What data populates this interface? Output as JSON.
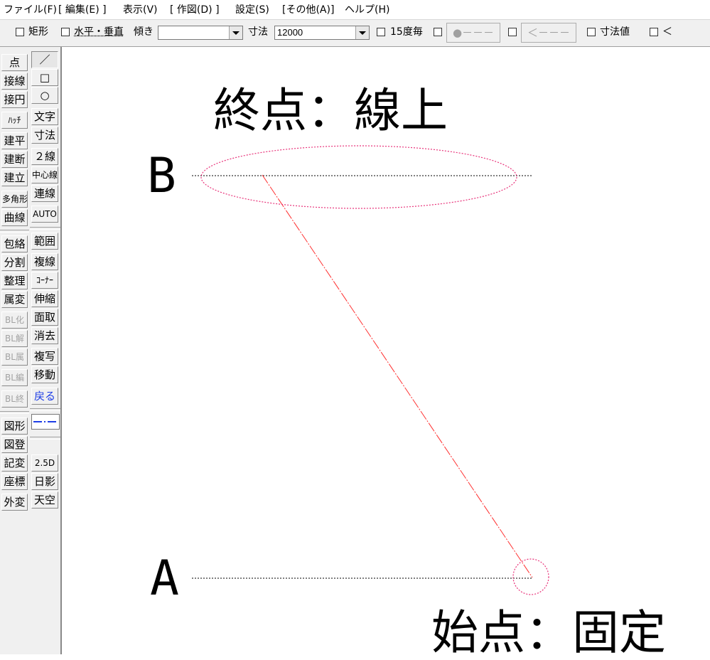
{
  "menu": [
    {
      "label": "ファイル(F)"
    },
    {
      "label": "[ 編集(E) ]"
    },
    {
      "label": "表示(V)"
    },
    {
      "label": "[ 作図(D) ]"
    },
    {
      "label": "設定(S)"
    },
    {
      "label": "[その他(A)]"
    },
    {
      "label": "ヘルプ(H)"
    }
  ],
  "toolbar": {
    "rect_label": "矩形",
    "horiz_vert_label": "水平・垂直",
    "tilt_label": "傾き",
    "tilt_value": "",
    "dim_label": "寸法",
    "dim_value": "12000",
    "deg15_label": "15度毎",
    "point_button": "●－－－",
    "arrow_button": "＜－－－",
    "dimval_label": "寸法値",
    "last_label": "＜"
  },
  "left_col1": [
    {
      "label": "点",
      "state": "normal"
    },
    {
      "label": "接線",
      "state": "normal"
    },
    {
      "label": "接円",
      "state": "normal"
    },
    {
      "label": "ﾊｯﾁ",
      "state": "normal"
    },
    {
      "label": "建平",
      "state": "normal"
    },
    {
      "label": "建断",
      "state": "normal"
    },
    {
      "label": "建立",
      "state": "normal"
    },
    {
      "label": "多角形",
      "state": "normal"
    },
    {
      "label": "曲線",
      "state": "normal"
    },
    {
      "label": "包絡",
      "state": "normal"
    },
    {
      "label": "分割",
      "state": "normal"
    },
    {
      "label": "整理",
      "state": "normal"
    },
    {
      "label": "属変",
      "state": "normal"
    },
    {
      "label": "BL化",
      "state": "disabled"
    },
    {
      "label": "BL解",
      "state": "disabled"
    },
    {
      "label": "BL属",
      "state": "disabled"
    },
    {
      "label": "BL編",
      "state": "disabled"
    },
    {
      "label": "BL終",
      "state": "disabled"
    },
    {
      "label": "図形",
      "state": "normal"
    },
    {
      "label": "図登",
      "state": "normal"
    },
    {
      "label": "記変",
      "state": "normal"
    },
    {
      "label": "座標",
      "state": "normal"
    },
    {
      "label": "外変",
      "state": "normal"
    }
  ],
  "left_col2": [
    {
      "label": "／",
      "state": "pressed"
    },
    {
      "label": "□",
      "state": "normal"
    },
    {
      "label": "○",
      "state": "normal"
    },
    {
      "label": "文字",
      "state": "normal"
    },
    {
      "label": "寸法",
      "state": "normal"
    },
    {
      "label": "２線",
      "state": "normal"
    },
    {
      "label": "中心線",
      "state": "normal"
    },
    {
      "label": "連線",
      "state": "normal"
    },
    {
      "label": "AUTO",
      "state": "normal"
    },
    {
      "label": "範囲",
      "state": "normal"
    },
    {
      "label": "複線",
      "state": "normal"
    },
    {
      "label": "ｺｰﾅｰ",
      "state": "normal"
    },
    {
      "label": "伸縮",
      "state": "normal"
    },
    {
      "label": "面取",
      "state": "normal"
    },
    {
      "label": "消去",
      "state": "normal"
    },
    {
      "label": "複写",
      "state": "normal"
    },
    {
      "label": "移動",
      "state": "normal"
    },
    {
      "label": "戻る",
      "state": "blue"
    },
    {
      "label": "",
      "state": "linetype"
    },
    {
      "label": "2.5D",
      "state": "normal"
    },
    {
      "label": "日影",
      "state": "normal"
    },
    {
      "label": "天空",
      "state": "normal"
    }
  ],
  "canvas": {
    "end_caption": "終点：線上",
    "start_caption": "始点：固定",
    "label_b": "B",
    "label_a": "A"
  },
  "colors": {
    "line": "#ff3030",
    "highlight": "#e8337a",
    "ref_line": "#000000",
    "disabled_text": "#a3a3a3",
    "back_text": "#1e3ee6"
  }
}
